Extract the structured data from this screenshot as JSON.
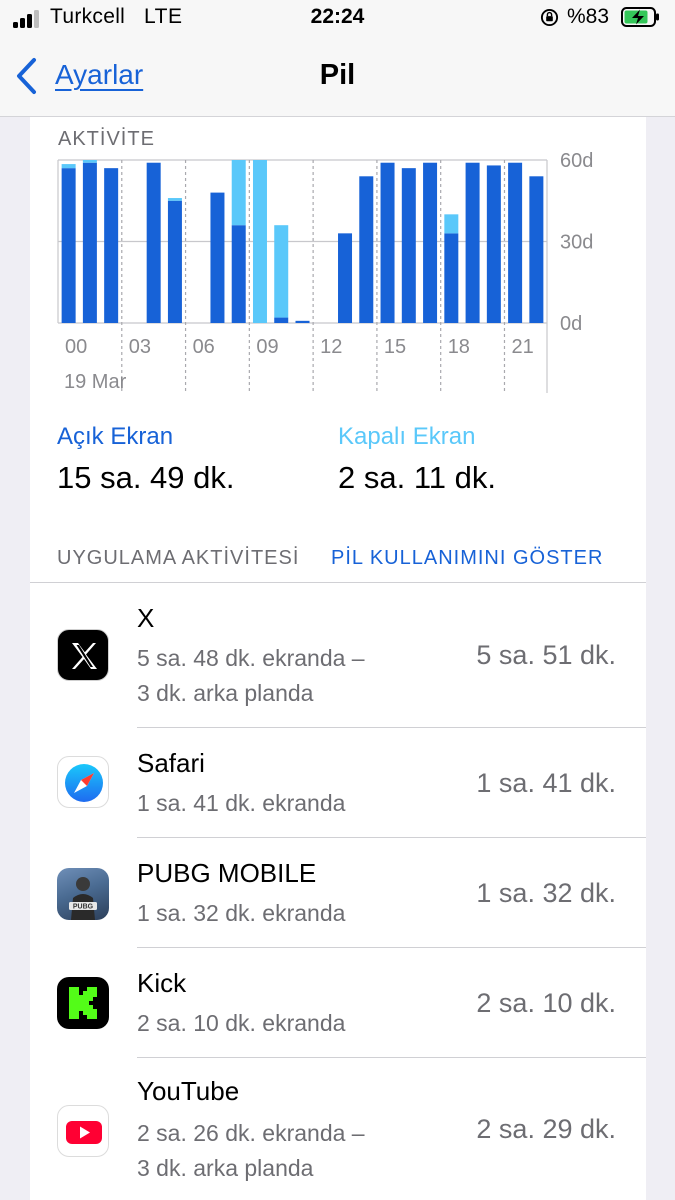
{
  "status_bar": {
    "carrier": "Turkcell",
    "network": "LTE",
    "time": "22:24",
    "battery_percent": "%83",
    "signal_bars": 3,
    "icons": [
      "signal-icon",
      "rotation-lock-icon",
      "battery-charging-icon"
    ]
  },
  "nav": {
    "back_label": "Ayarlar",
    "title": "Pil",
    "icons": [
      "chevron-left-icon"
    ]
  },
  "activity": {
    "section_label": "AKTİVİTE",
    "date_label": "19 Mar",
    "screen_on_label": "Açık Ekran",
    "screen_on_total": "15 sa. 49 dk.",
    "screen_off_label": "Kapalı Ekran",
    "screen_off_total": "2 sa. 11 dk."
  },
  "chart_data": {
    "type": "bar",
    "stacked": true,
    "x_tick_labels": [
      "00",
      "03",
      "06",
      "09",
      "12",
      "15",
      "18",
      "21"
    ],
    "y_tick_labels": [
      "60d",
      "30d",
      "0d"
    ],
    "ylim": [
      0,
      60
    ],
    "grid": true,
    "hours": [
      0,
      1,
      2,
      3,
      4,
      5,
      6,
      7,
      8,
      9,
      10,
      11,
      12,
      13,
      14,
      15,
      16,
      17,
      18,
      19,
      20,
      21
    ],
    "series": [
      {
        "name": "Açık Ekran",
        "color": "#1762d7",
        "values": [
          57,
          59,
          57,
          0,
          59,
          45,
          0,
          48,
          36,
          0,
          2,
          0.8,
          0,
          33,
          54,
          59,
          57,
          59,
          33,
          59,
          58,
          59,
          54
        ]
      },
      {
        "name": "Kapalı Ekran",
        "color": "#5ac8fa",
        "values": [
          1.5,
          1,
          0,
          0,
          0,
          1,
          0,
          0,
          24,
          60,
          34,
          0,
          0,
          0,
          0,
          0,
          0,
          0,
          7,
          0,
          0,
          0,
          0
        ]
      }
    ]
  },
  "apps": {
    "header": "UYGULAMA AKTİVİTESİ",
    "show_battery_link": "PİL KULLANIMINI GÖSTER",
    "items": [
      {
        "name": "X",
        "detail_line1": "5 sa. 48 dk. ekranda –",
        "detail_line2": "3 dk. arka planda",
        "total": "5 sa. 51 dk.",
        "icon": "x-app-icon"
      },
      {
        "name": "Safari",
        "detail_line1": "1 sa. 41 dk. ekranda",
        "detail_line2": "",
        "total": "1 sa. 41 dk.",
        "icon": "safari-icon"
      },
      {
        "name": "PUBG MOBILE",
        "detail_line1": "1 sa. 32 dk. ekranda",
        "detail_line2": "",
        "total": "1 sa. 32 dk.",
        "icon": "pubg-icon"
      },
      {
        "name": "Kick",
        "detail_line1": "2 sa. 10 dk. ekranda",
        "detail_line2": "",
        "total": "2 sa. 10 dk.",
        "icon": "kick-icon"
      },
      {
        "name": "YouTube",
        "detail_line1": "2 sa. 26 dk. ekranda –",
        "detail_line2": "3 dk. arka planda",
        "total": "2 sa. 29 dk.",
        "icon": "youtube-icon"
      }
    ]
  }
}
